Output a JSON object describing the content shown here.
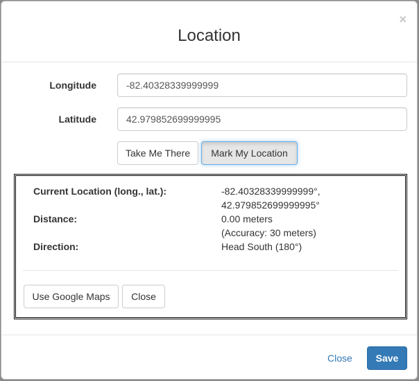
{
  "modal": {
    "title": "Location",
    "close_glyph": "×"
  },
  "form": {
    "longitude_label": "Longitude",
    "longitude_value": "-82.40328339999999",
    "latitude_label": "Latitude",
    "latitude_value": "42.979852699999995",
    "take_me_there_label": "Take Me There",
    "mark_location_label": "Mark My Location"
  },
  "info": {
    "current_location_label": "Current Location (long., lat.):",
    "current_location_line1": "-82.40328339999999°,",
    "current_location_line2": "42.979852699999995°",
    "distance_label": "Distance:",
    "distance_value": "0.00 meters",
    "accuracy_value": "(Accuracy: 30 meters)",
    "direction_label": "Direction:",
    "direction_value": "Head South (180°)",
    "google_maps_label": "Use Google Maps",
    "close_label": "Close"
  },
  "footer": {
    "close_label": "Close",
    "save_label": "Save"
  },
  "colors": {
    "primary": "#337ab7",
    "link": "#337ab7",
    "focus_border": "#66afe9"
  }
}
